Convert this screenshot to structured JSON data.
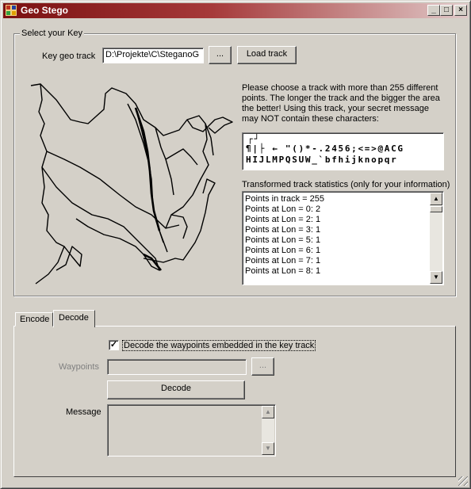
{
  "window": {
    "title": "Geo Stego",
    "controls": {
      "minimize": "_",
      "maximize": "□",
      "close": "×"
    }
  },
  "key_group": {
    "legend": "Select your Key",
    "key_label": "Key geo track",
    "key_path_value": "D:\\Projekte\\C\\SteganoG",
    "browse_label": "...",
    "load_label": "Load track",
    "info_text_lines": [
      "Please choose a track with more than 255 different",
      "points. The longer the track and the bigger the area",
      "the better! Using this track, your secret message",
      "may NOT contain these characters:"
    ],
    "forbidden_lines": [
      "┌┘",
      "¶|├ ← \"()*-.2456;<=>@ACG",
      "HIJLMPQSUW_`bfhijknopqr"
    ],
    "stats_label": "Transformed track statistics (only for your information)",
    "stats_items": [
      "Points in track = 255",
      "Points at Lon = 0: 2",
      "Points at Lon = 2: 1",
      "Points at Lon = 3: 1",
      "Points at Lon = 5: 1",
      "Points at Lon = 6: 1",
      "Points at Lon = 7: 1",
      "Points at Lon = 8: 1"
    ]
  },
  "tabs": {
    "encode": "Encode",
    "decode": "Decode",
    "active": "Decode"
  },
  "decode": {
    "checkbox_checked": true,
    "checkbox_mark": "✓",
    "checkbox_label": "Decode the waypoints embedded in the key track",
    "waypoints_label": "Waypoints",
    "waypoints_value": "",
    "waypoints_browse": "...",
    "decode_button": "Decode",
    "message_label": "Message",
    "message_value": ""
  }
}
